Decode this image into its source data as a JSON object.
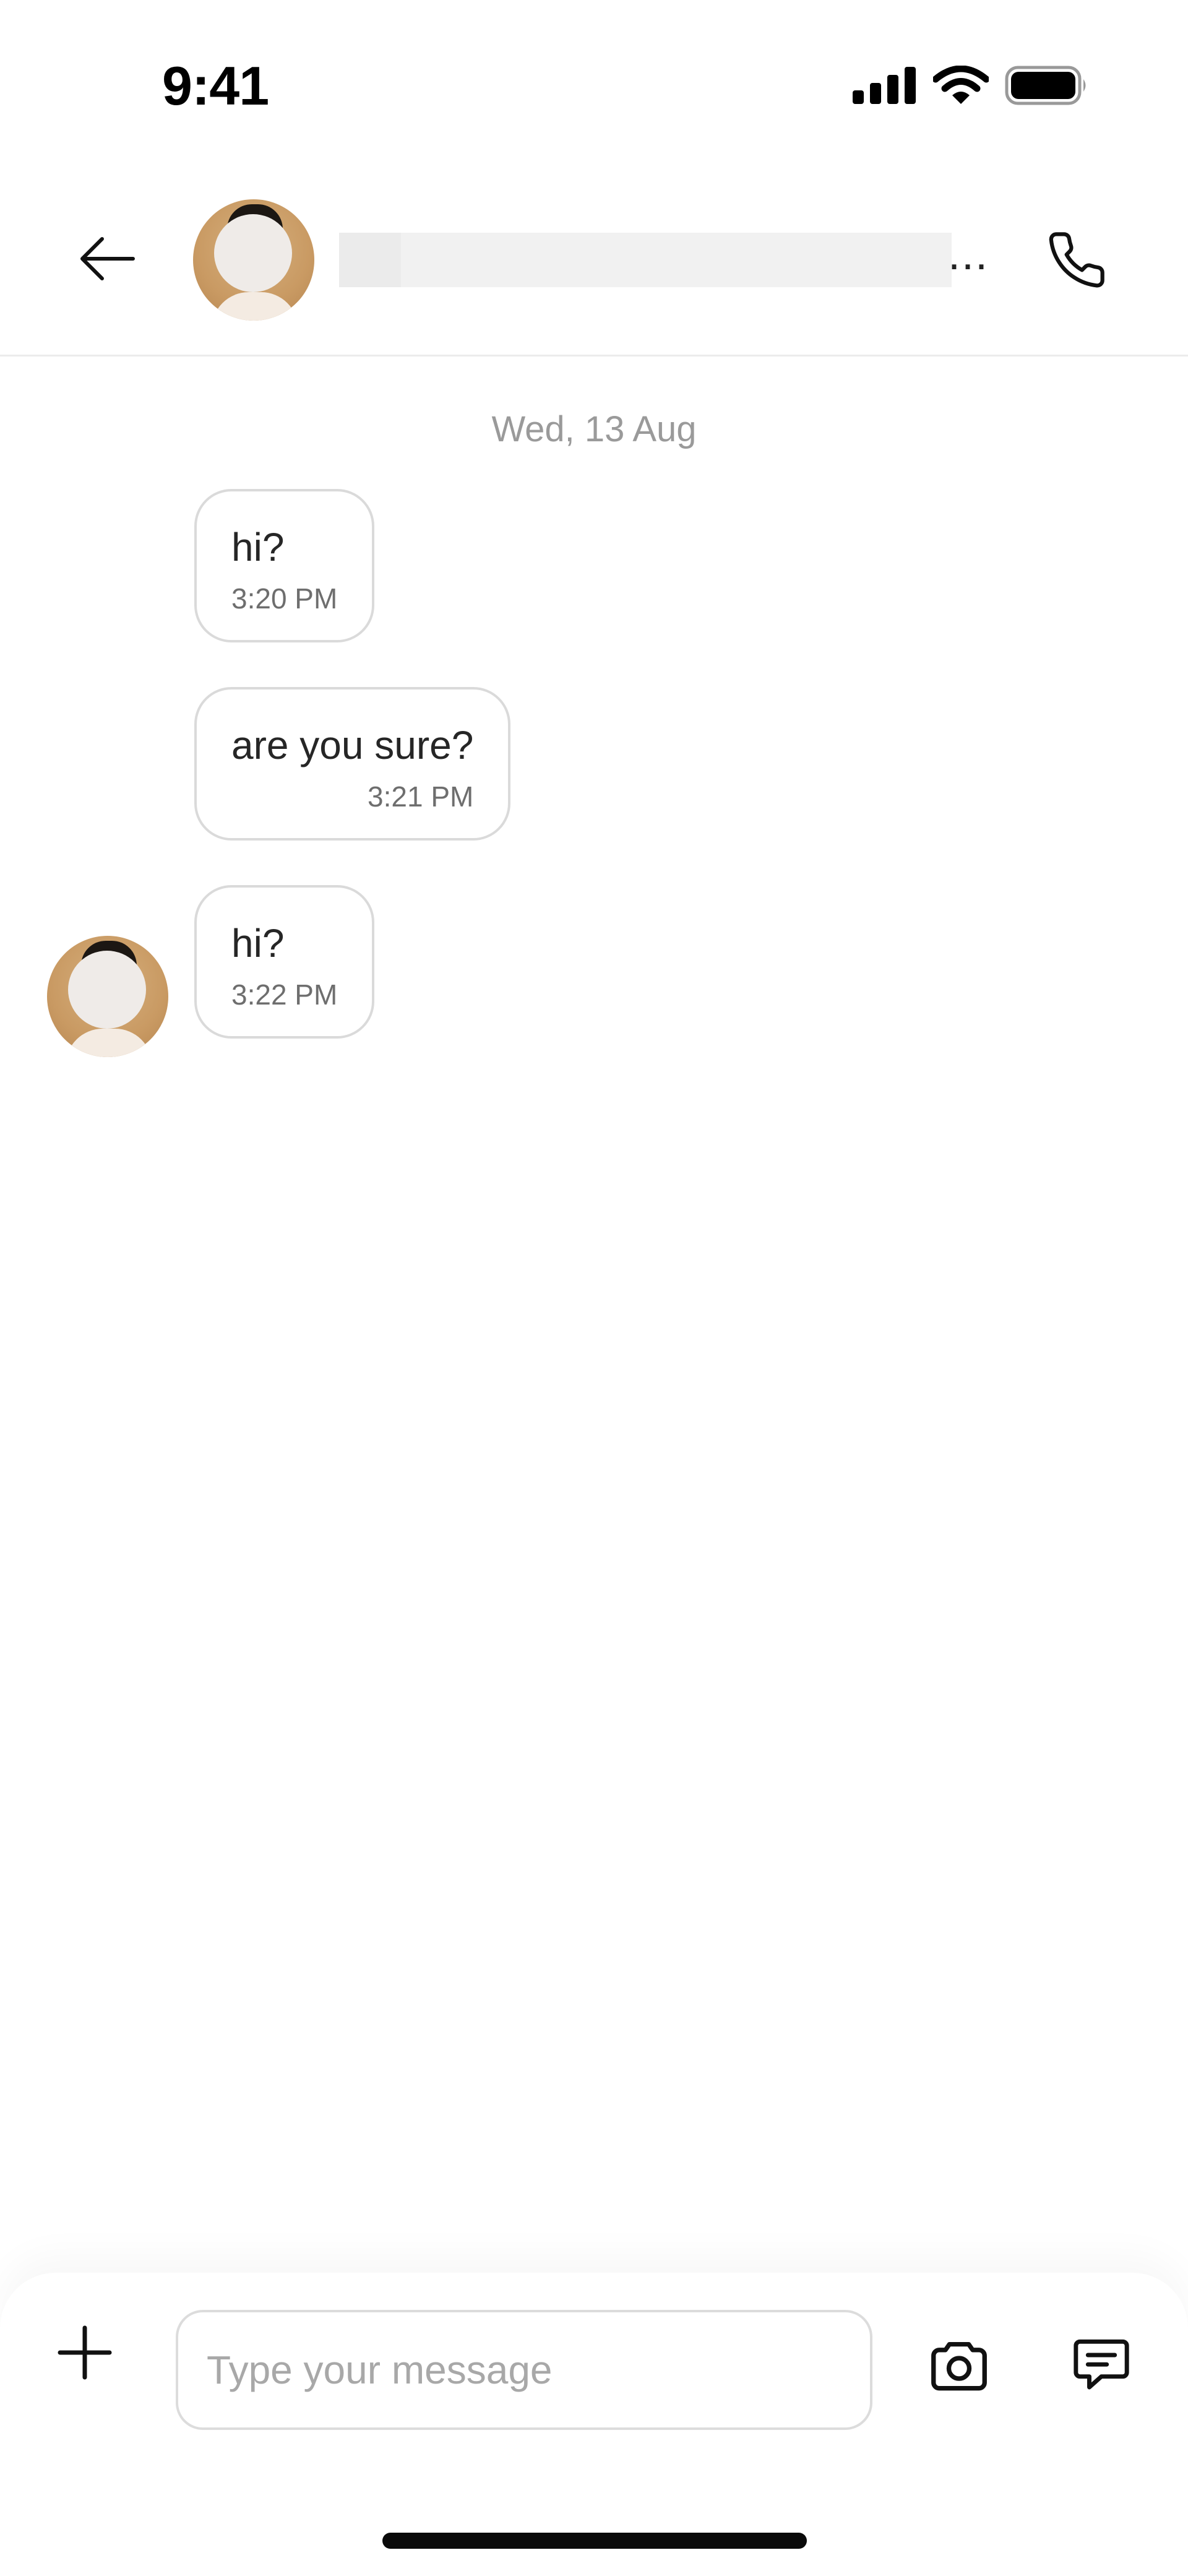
{
  "status_bar": {
    "time": "9:41",
    "icons": [
      "signal-icon",
      "wifi-icon",
      "battery-icon"
    ]
  },
  "header": {
    "back_icon": "arrow-left-icon",
    "contact_name_ellipsis": "...",
    "call_icon": "phone-icon"
  },
  "conversation": {
    "date_divider": "Wed, 13 Aug",
    "messages": [
      {
        "text": "hi?",
        "time": "3:20 PM"
      },
      {
        "text": "are you sure?",
        "time": "3:21 PM"
      },
      {
        "text": "hi?",
        "time": "3:22 PM"
      }
    ]
  },
  "composer": {
    "placeholder": "Type your message",
    "value": "",
    "icons": [
      "plus-icon",
      "camera-icon",
      "message-icon"
    ]
  },
  "colors": {
    "bubble_border": "#dadada",
    "date_text": "#9a9a9a",
    "divider": "#ececec"
  }
}
